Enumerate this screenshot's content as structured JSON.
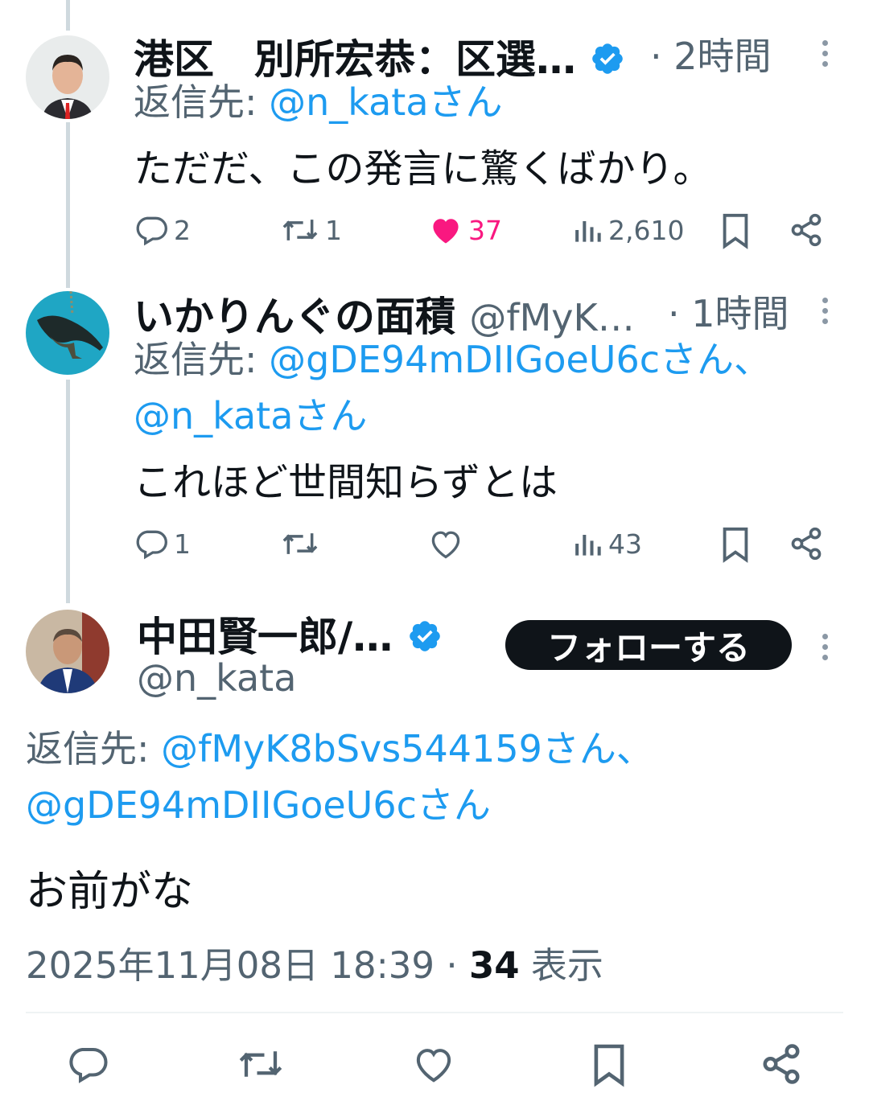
{
  "tweets": [
    {
      "name": "港区　別所宏恭：区選…",
      "time": "2時間",
      "reply_label": "返信先:",
      "reply_to": "@n_kataさん",
      "text": "ただだ、この発言に驚くばかり。",
      "replies": "2",
      "retweets": "1",
      "likes": "37",
      "views": "2,610",
      "liked": true,
      "verified": true
    },
    {
      "name": "いかりんぐの面積",
      "handle": "@fMyK…",
      "time": "1時間",
      "reply_label": "返信先:",
      "reply_to_line1": "@gDE94mDIIGoeU6cさん、",
      "reply_to_line2": "@n_kataさん",
      "text": "これほど世間知らずとは",
      "replies": "1",
      "views": "43"
    }
  ],
  "main_tweet": {
    "name": "中田賢一郎/…",
    "handle": "@n_kata",
    "follow_label": "フォローする",
    "reply_label": "返信先:",
    "reply_to_line1": "@fMyK8bSvs544159さん、",
    "reply_to_line2": "@gDE94mDIIGoeU6cさん",
    "text": "お前がな",
    "datetime": "2025年11月08日 18:39 · ",
    "view_count": "34",
    "view_label": " 表示"
  },
  "icons": [
    "reply-icon",
    "retweet-icon",
    "like-icon",
    "views-icon",
    "bookmark-icon",
    "share-icon",
    "verified-icon",
    "more-icon"
  ],
  "colors": {
    "link": "#1d9bf0",
    "like": "#f91880",
    "muted": "#536471",
    "verified": "#1d9bf0"
  }
}
